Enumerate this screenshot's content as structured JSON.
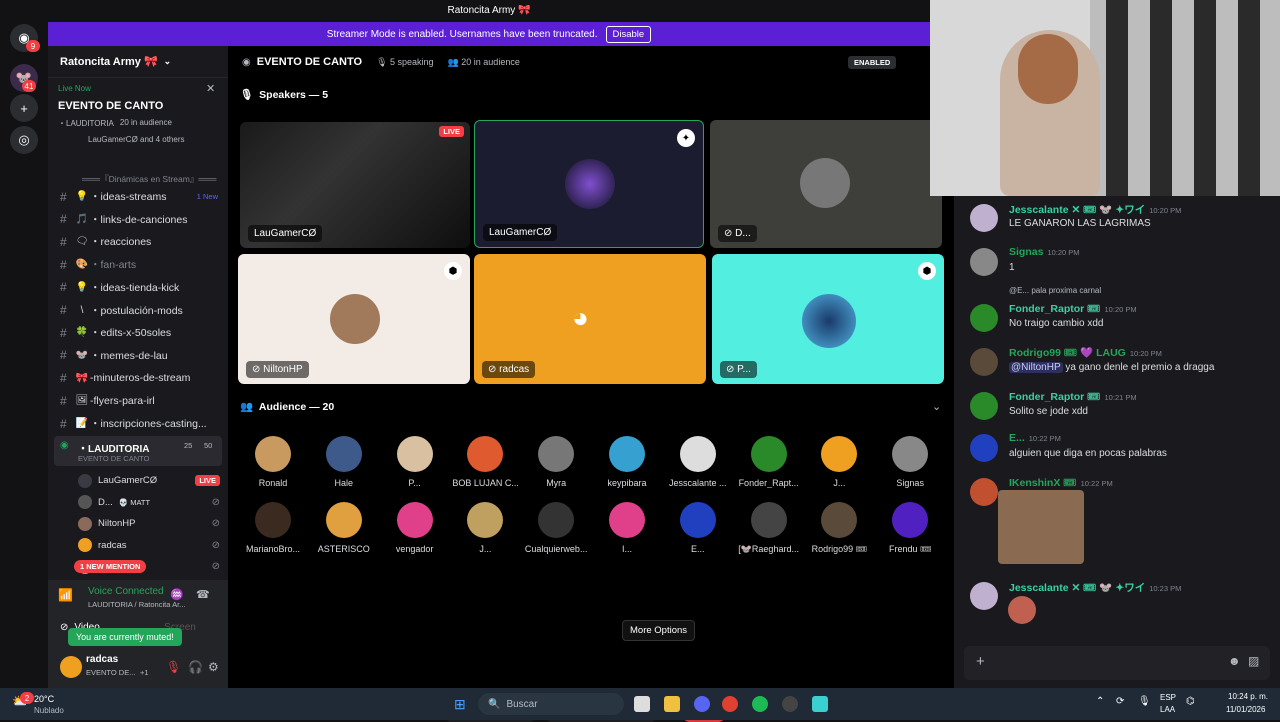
{
  "title_bar": {
    "title": "Ratoncita Army 🎀"
  },
  "streamer_banner": {
    "text": "Streamer Mode is enabled. Usernames have been truncated.",
    "button": "Disable"
  },
  "rail": {
    "badge_top": "9",
    "badge_second": "41"
  },
  "server": {
    "name": "Ratoncita Army 🎀",
    "live_now": "Live Now",
    "event_title": "EVENTO DE CANTO",
    "event_channel": "・LAUDITORIA",
    "event_audience": "20 in audience",
    "event_users": "LauGamerCØ and 4 others",
    "category": "═══『Dinámicas en Stream』═══",
    "channels": [
      {
        "emoji": "💡",
        "label": "・ideas-streams",
        "badge": "1 New",
        "dim": false
      },
      {
        "emoji": "🎵",
        "label": "・links-de-canciones",
        "badge": "",
        "dim": false
      },
      {
        "emoji": "🗨",
        "label": "・reacciones",
        "badge": "",
        "dim": false
      },
      {
        "emoji": "🎨",
        "label": "・fan-arts",
        "badge": "",
        "dim": true
      },
      {
        "emoji": "💡",
        "label": "・ideas-tienda-kick",
        "badge": "",
        "dim": false
      },
      {
        "emoji": "\\",
        "label": "・postulación-mods",
        "badge": "",
        "dim": false
      },
      {
        "emoji": "🍀",
        "label": "・edits-x-50soles",
        "badge": "",
        "dim": false
      },
      {
        "emoji": "🐭",
        "label": "・memes-de-lau",
        "badge": "",
        "dim": false
      },
      {
        "emoji": "🎀",
        "label": "-minuteros-de-stream",
        "badge": "",
        "dim": false
      },
      {
        "emoji": "🖼",
        "label": "-flyers-para-irl",
        "badge": "",
        "dim": false
      },
      {
        "emoji": "📝",
        "label": "・inscripciones-casting...",
        "badge": "",
        "dim": false
      }
    ],
    "stage_channel": {
      "label": "・LAUDITORIA",
      "sub": "EVENTO DE CANTO",
      "count_a": "25",
      "count_b": "50"
    },
    "voice_users": [
      {
        "name": "LauGamerCØ",
        "tag": "LIVE",
        "color": "#3a3a44"
      },
      {
        "name": "D...",
        "tag": "💀 MATT",
        "color": "#555"
      },
      {
        "name": "NiltonHP",
        "tag": "",
        "color": "#8a6a5a"
      },
      {
        "name": "radcas",
        "tag": "",
        "color": "#f0a020"
      },
      {
        "name": "P...",
        "tag": "1 NEW MENTION",
        "color": "#3ad0d0"
      }
    ],
    "voice_connected": "Voice Connected",
    "voice_location": "LAUDITORIA / Ratoncita Ar...",
    "video_label": "Video",
    "screen_label": "Screen",
    "muted_toast": "You are currently muted!",
    "user_name": "radcas",
    "user_status": "EVENTO DE...",
    "user_status_extra": "+1"
  },
  "stage": {
    "title": "EVENTO DE CANTO",
    "speaking": "5 speaking",
    "audience_count": "20 in audience",
    "enabled": "ENABLED",
    "speakers_heading": "Speakers — 5",
    "audience_heading": "Audience — 20",
    "tiles": [
      {
        "label": "LauGamerCØ",
        "live": "LIVE"
      },
      {
        "label": "LauGamerCØ"
      },
      {
        "label": "D..."
      },
      {
        "label": "NiltonHP"
      },
      {
        "label": "radcas"
      },
      {
        "label": "P..."
      }
    ],
    "audience": [
      {
        "name": "Ronald",
        "color": "#c89a60"
      },
      {
        "name": "Hale",
        "color": "#3d5a8a"
      },
      {
        "name": "P...",
        "color": "#d8c0a0"
      },
      {
        "name": "BOB LUJAN C...",
        "color": "#e05a30"
      },
      {
        "name": "Myra",
        "color": "#777"
      },
      {
        "name": "keypibara",
        "color": "#36a0d0"
      },
      {
        "name": "Jesscalante ...",
        "color": "#ddd"
      },
      {
        "name": "Fonder_Rapt...",
        "color": "#2a8a2a"
      },
      {
        "name": "J...",
        "color": "#f0a020"
      },
      {
        "name": "Signas",
        "color": "#888"
      },
      {
        "name": "MarianoBro...",
        "color": "#3a2a20"
      },
      {
        "name": "ASTERISCO",
        "color": "#e0a040"
      },
      {
        "name": "vengador",
        "color": "#e0408a"
      },
      {
        "name": "J...",
        "color": "#c0a060"
      },
      {
        "name": "Cualquierweb...",
        "color": "#333"
      },
      {
        "name": "I...",
        "color": "#e0408a"
      },
      {
        "name": "E...",
        "color": "#2040c0"
      },
      {
        "name": "[🐭Raeghard...",
        "color": "#444"
      },
      {
        "name": "Rodrigo99 🎟",
        "color": "#5a4a3a"
      },
      {
        "name": "Frendu 🎟",
        "color": "#5020c0"
      }
    ],
    "tooltip": "More Options"
  },
  "chat": {
    "messages": [
      {
        "name": "Jesscalante ✕ 🎟 🐭 ✦ワイ",
        "time": "10:20 PM",
        "text": "LE GANARON LAS LAGRIMAS",
        "color": "#3ad0a0",
        "avatar": "#c0b0d0"
      },
      {
        "name": "Signas",
        "time": "10:20 PM",
        "text": "1",
        "color": "#23a55a",
        "avatar": "#888"
      },
      {
        "name": "Fonder_Raptor 🎟",
        "time": "10:20 PM",
        "text": "No traigo cambio xdd",
        "color": "#3ad0a0",
        "avatar": "#2a8a2a",
        "reply": "@E... pala proxima carnal"
      },
      {
        "name": "Rodrigo99 🎟 💜 LAUG",
        "time": "10:20 PM",
        "text": "ya gano denle el premio a dragga",
        "color": "#23a55a",
        "avatar": "#5a4a3a",
        "mention": "@NiltonHP"
      },
      {
        "name": "Fonder_Raptor 🎟",
        "time": "10:21 PM",
        "text": "Solito se jode xdd",
        "color": "#3ad0a0",
        "avatar": "#2a8a2a"
      },
      {
        "name": "E...",
        "time": "10:22 PM",
        "text": "alguien que diga en pocas palabras",
        "color": "#23a55a",
        "avatar": "#2040c0"
      },
      {
        "name": "IKenshinX 🎟",
        "time": "10:22 PM",
        "text": "",
        "color": "#23a55a",
        "avatar": "#c05030"
      },
      {
        "name": "Jesscalante ✕ 🎟 🐭 ✦ワイ",
        "time": "10:23 PM",
        "text": "",
        "color": "#3ad0a0",
        "avatar": "#c0b0d0"
      }
    ]
  },
  "taskbar": {
    "weather_temp": "20°C",
    "weather_desc": "Nublado",
    "search_placeholder": "Buscar",
    "lang": "ESP",
    "lang_sub": "LAA",
    "time": "10:24 p. m.",
    "date": "11/01/2026",
    "weather_badge": "2"
  }
}
